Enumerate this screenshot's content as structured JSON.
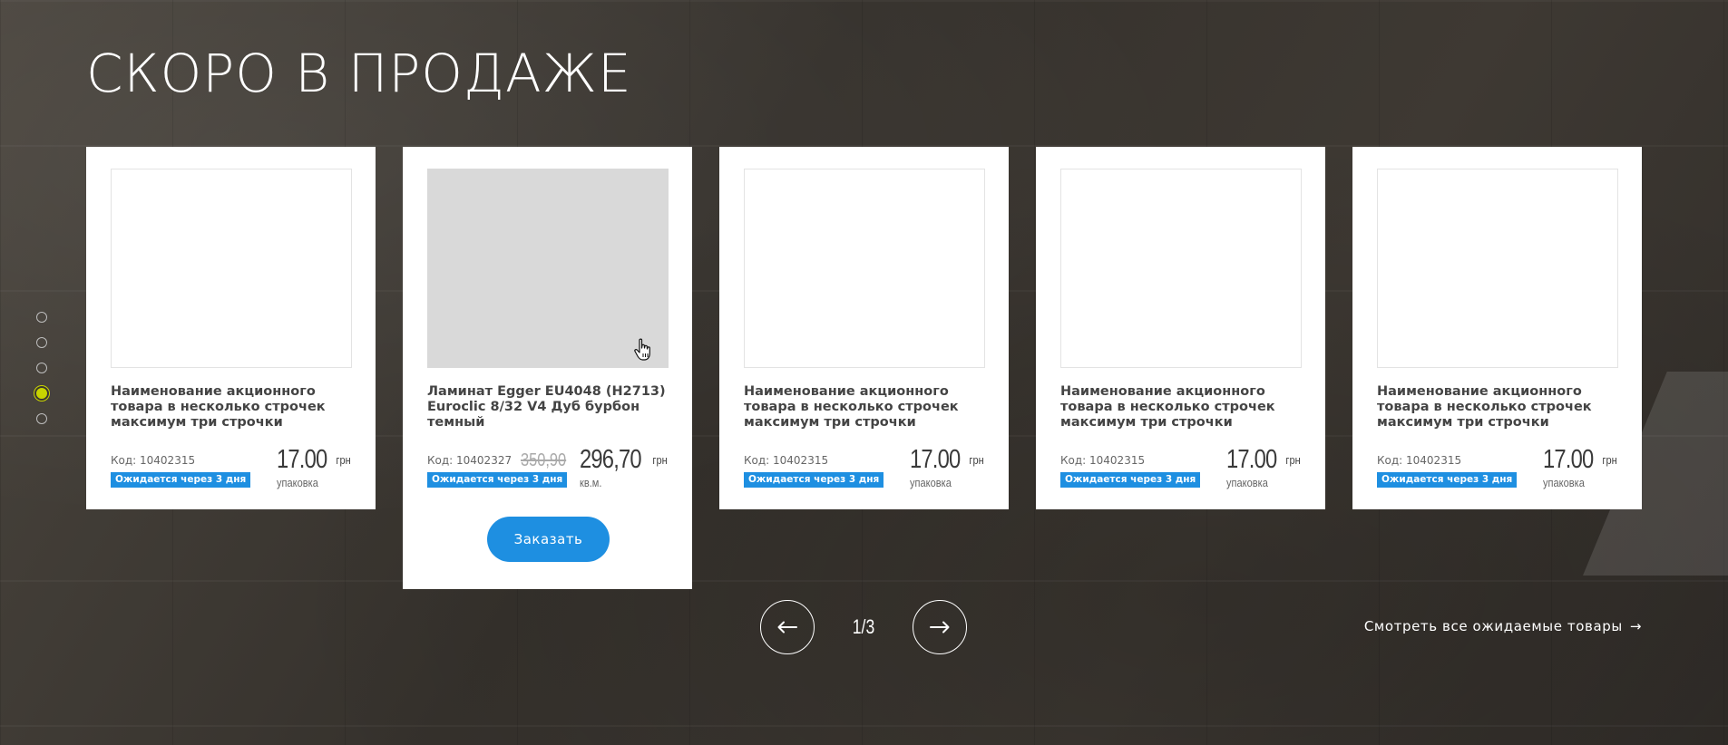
{
  "section": {
    "title": "СКОРО В ПРОДАЖЕ"
  },
  "dots": {
    "count": 5,
    "active_index": 3
  },
  "products": [
    {
      "name": "Наименование акционного товара в несколько строчек максимум три строчки",
      "code": "Код: 10402315",
      "badge": "Ожидается через 3 дня",
      "price_old": "",
      "price": "17.00",
      "currency": "грн",
      "unit": "упаковка"
    },
    {
      "name": "Ламинат Egger EU4048 (H2713) Euroclic 8/32 V4 Дуб бурбон темный",
      "code": "Код: 10402327",
      "badge": "Ожидается через 3 дня",
      "price_old": "350,90",
      "price": "296,70",
      "currency": "грн",
      "unit": "кв.м."
    },
    {
      "name": "Наименование акционного товара в несколько строчек максимум три строчки",
      "code": "Код: 10402315",
      "badge": "Ожидается через 3 дня",
      "price_old": "",
      "price": "17.00",
      "currency": "грн",
      "unit": "упаковка"
    },
    {
      "name": "Наименование акционного товара в несколько строчек максимум три строчки",
      "code": "Код: 10402315",
      "badge": "Ожидается через 3 дня",
      "price_old": "",
      "price": "17.00",
      "currency": "грн",
      "unit": "упаковка"
    },
    {
      "name": "Наименование акционного товара в несколько строчек максимум три строчки",
      "code": "Код: 10402315",
      "badge": "Ожидается через 3 дня",
      "price_old": "",
      "price": "17.00",
      "currency": "грн",
      "unit": "упаковка"
    }
  ],
  "order_button": {
    "label": "Заказать"
  },
  "pager": {
    "text": "1/3",
    "prev_icon": "arrow-left-icon",
    "next_icon": "arrow-right-icon"
  },
  "view_all": {
    "label": "Смотреть все ожидаемые товары",
    "arrow": "→"
  },
  "colors": {
    "accent_blue": "#1e8fe1",
    "active_dot": "#c8d400",
    "background": "#3a3631"
  }
}
